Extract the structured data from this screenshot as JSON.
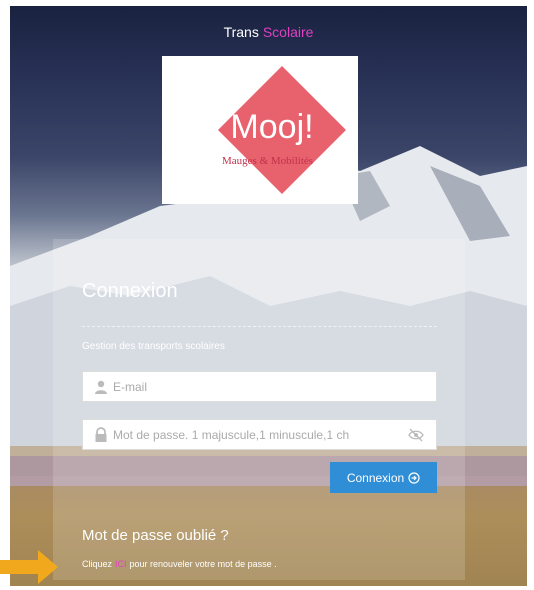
{
  "brand": {
    "part1": "Trans",
    "part2": "Scolaire"
  },
  "logo": {
    "main": "Mooj!",
    "sub": "Mauges & Mobilités"
  },
  "login": {
    "title": "Connexion",
    "subtitle": "Gestion des transports scolaires",
    "email_placeholder": "E-mail",
    "password_placeholder": "Mot de passe. 1 majuscule,1 minuscule,1 ch",
    "button_label": "Connexion"
  },
  "forgot": {
    "title": "Mot de passe oublié ?",
    "prefix": "Cliquez",
    "link": "ICI",
    "suffix": "pour renouveler votre mot de passe ."
  },
  "colors": {
    "accent": "#e040c0",
    "button": "#2f8ed6",
    "logo": "#e8626e",
    "arrow": "#f2a81d"
  }
}
